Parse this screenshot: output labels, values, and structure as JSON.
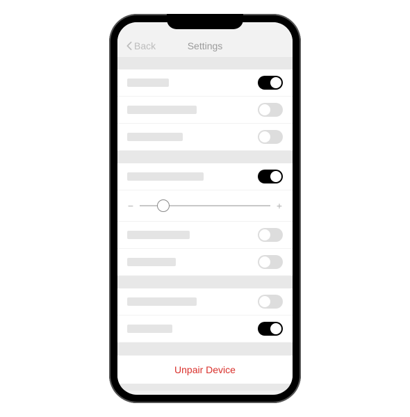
{
  "header": {
    "back_label": "Back",
    "title": "Settings"
  },
  "sections": [
    {
      "toggles": [
        true,
        false,
        false
      ]
    },
    {
      "toggles": [
        true,
        null,
        false,
        false
      ]
    },
    {
      "toggles": [
        false,
        true
      ]
    }
  ],
  "slider": {
    "value": 18,
    "min_icon": "−",
    "max_icon": "+"
  },
  "danger": {
    "unpair_label": "Unpair Device"
  },
  "skeleton_widths": [
    60,
    100,
    80,
    110,
    90,
    70,
    100,
    65
  ]
}
